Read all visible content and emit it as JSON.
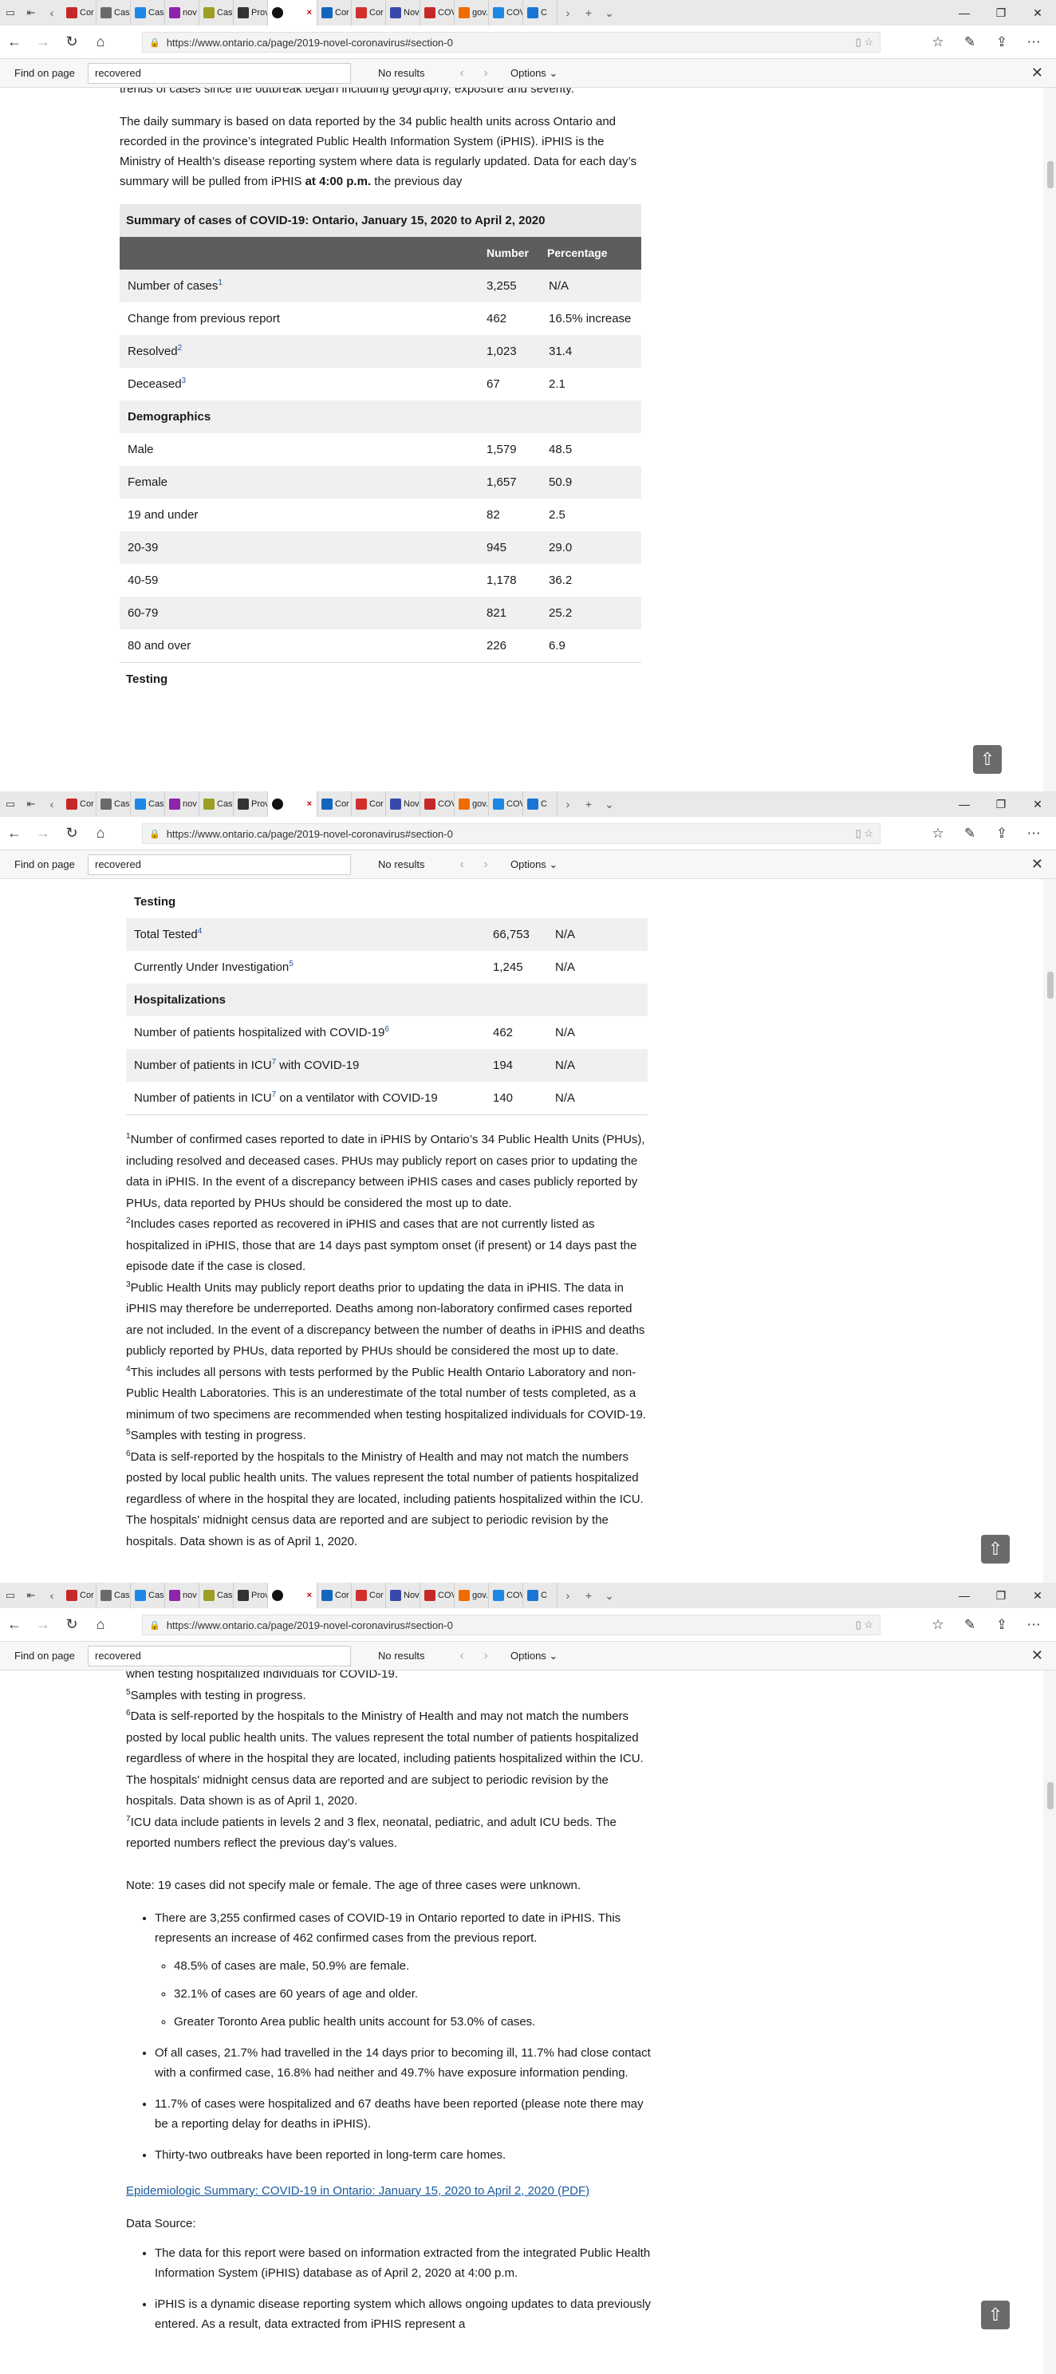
{
  "browser": {
    "url": "https://www.ontario.ca/page/2019-novel-coronavirus#section-0",
    "tabs": [
      {
        "label": "Cor",
        "color": "#c62828"
      },
      {
        "label": "Case",
        "color": "#6a6a6a"
      },
      {
        "label": "Case",
        "color": "#1e88e5"
      },
      {
        "label": "nov",
        "color": "#8e24aa"
      },
      {
        "label": "Case",
        "color": "#9e9d24"
      },
      {
        "label": "Prov",
        "color": "#333333"
      },
      {
        "label": "",
        "color": "#111111"
      },
      {
        "label": "Cor",
        "color": "#1565c0"
      },
      {
        "label": "Cor",
        "color": "#d32f2f"
      },
      {
        "label": "Nov",
        "color": "#3949ab"
      },
      {
        "label": "COV",
        "color": "#c62828"
      },
      {
        "label": "gov.",
        "color": "#ef6c00"
      },
      {
        "label": "COV",
        "color": "#1e88e5"
      },
      {
        "label": "C",
        "color": "#1976d2"
      }
    ],
    "active_tab_close": "×",
    "find": {
      "label": "Find on page",
      "query": "recovered",
      "result": "No results",
      "options": "Options"
    }
  },
  "page": {
    "intro_tail": "trends of cases since the outbreak began including geography, exposure and severity.",
    "intro_para": "The daily summary is based on data reported by the 34 public health units across Ontario and recorded in the province’s integrated Public Health Information System (iPHIS). iPHIS is the Ministry of Health’s disease reporting system where data is regularly updated. Data for each day’s summary will be pulled from iPHIS",
    "intro_bold": "at 4:00 p.m.",
    "intro_end": "the previous day",
    "table": {
      "caption": "Summary of cases of COVID-19: Ontario, January 15, 2020 to April 2, 2020",
      "col_number": "Number",
      "col_percentage": "Percentage",
      "rows_top": [
        {
          "label": "Number of cases",
          "sup": "1",
          "number": "3,255",
          "pct": "N/A"
        },
        {
          "label": "Change from previous report",
          "sup": "",
          "number": "462",
          "pct": "16.5% increase"
        },
        {
          "label": "Resolved",
          "sup": "2",
          "number": "1,023",
          "pct": "31.4"
        },
        {
          "label": "Deceased",
          "sup": "3",
          "number": "67",
          "pct": "2.1"
        }
      ],
      "demographics_heading": "Demographics",
      "rows_demo": [
        {
          "label": "Male",
          "number": "1,579",
          "pct": "48.5"
        },
        {
          "label": "Female",
          "number": "1,657",
          "pct": "50.9"
        },
        {
          "label": "19 and under",
          "number": "82",
          "pct": "2.5"
        },
        {
          "label": "20-39",
          "number": "945",
          "pct": "29.0"
        },
        {
          "label": "40-59",
          "number": "1,178",
          "pct": "36.2"
        },
        {
          "label": "60-79",
          "number": "821",
          "pct": "25.2"
        },
        {
          "label": "80 and over",
          "number": "226",
          "pct": "6.9"
        }
      ],
      "testing_heading": "Testing",
      "rows_testing": [
        {
          "label": "Total Tested",
          "sup": "4",
          "number": "66,753",
          "pct": "N/A"
        },
        {
          "label": "Currently Under Investigation",
          "sup": "5",
          "number": "1,245",
          "pct": "N/A"
        }
      ],
      "hosp_heading": "Hospitalizations",
      "rows_hosp": [
        {
          "label": "Number of patients hospitalized with COVID-19",
          "sup": "6",
          "after": "",
          "number": "462",
          "pct": "N/A"
        },
        {
          "label": "Number of patients in ICU",
          "sup": "7",
          "after": " with COVID-19",
          "number": "194",
          "pct": "N/A"
        },
        {
          "label": "Number of patients in ICU",
          "sup": "7",
          "after": " on a ventilator with COVID-19",
          "number": "140",
          "pct": "N/A"
        }
      ]
    },
    "footnotes": [
      {
        "sup": "1",
        "text": "Number of confirmed cases reported to date in iPHIS by Ontario’s 34 Public Health Units (PHUs), including resolved and deceased cases.  PHUs may publicly report on cases prior to updating the data in iPHIS.  In the event of a discrepancy between iPHIS cases and cases publicly reported by PHUs, data reported by PHUs should be considered the most up to date."
      },
      {
        "sup": "2",
        "text": "Includes cases reported as recovered in iPHIS and cases that are not currently listed as hospitalized in iPHIS, those that are 14 days past symptom onset (if present) or 14 days past the episode date if the case is closed."
      },
      {
        "sup": "3",
        "text": "Public Health Units may publicly report deaths prior to updating the data in iPHIS. The data in iPHIS may therefore be underreported. Deaths among non-laboratory confirmed cases reported are not included. In the event of a discrepancy between the number of deaths in iPHIS and deaths publicly reported by PHUs, data reported by PHUs should be considered the most up to date."
      },
      {
        "sup": "4",
        "text": "This includes all persons with tests performed by the Public Health Ontario Laboratory  and non-Public Health Laboratories.  This is an underestimate of the total number of tests completed, as a minimum of two specimens are recommended when testing hospitalized individuals for COVID-19."
      },
      {
        "sup": "5",
        "text": "Samples with testing in progress."
      },
      {
        "sup": "6",
        "text": "Data is self-reported by the hospitals to the Ministry of Health and may not match the numbers posted by local public health units. The values represent the total number of patients hospitalized regardless of where in the hospital they are located, including patients hospitalized within the ICU. The hospitals' midnight census data are reported and are subject to periodic revision by the hospitals. Data shown is as of April 1, 2020."
      },
      {
        "sup": "7",
        "text": "ICU data include patients in levels 2 and 3  flex, neonatal, pediatric, and adult ICU beds. The reported numbers reflect the previous day’s values."
      }
    ],
    "note": "Note: 19 cases did not specify male or female. The age of three cases were unknown.",
    "bullet1": "There are 3,255 confirmed cases of COVID-19 in Ontario reported to date in iPHIS. This represents an increase of 462 confirmed cases from the previous report.",
    "sub_bullets": [
      "48.5% of cases are male, 50.9% are female.",
      "32.1% of cases are 60 years of age and older.",
      "Greater Toronto Area public health units account for 53.0% of cases."
    ],
    "bullet2": "Of all cases, 21.7% had travelled in the 14 days prior to becoming ill, 11.7% had close contact with a confirmed case, 16.8% had neither and 49.7% have exposure information pending.",
    "bullet3": "11.7% of cases were hospitalized and 67 deaths have been reported (please note there may be a reporting delay for deaths in iPHIS).",
    "bullet4": "Thirty-two outbreaks have been reported in long-term care homes.",
    "pdf_link": "Epidemiologic Summary: COVID-19 in Ontario: January 15, 2020 to April 2, 2020 (PDF)",
    "data_source_label": "Data Source:",
    "ds_bullet1": "The data for this report were based on information extracted from the integrated Public Health Information System (iPHIS) database as of April 2, 2020 at 4:00 p.m.",
    "ds_bullet2": "iPHIS is a dynamic disease reporting system which allows ongoing updates to data previously entered. As a result, data extracted from iPHIS represent a"
  }
}
